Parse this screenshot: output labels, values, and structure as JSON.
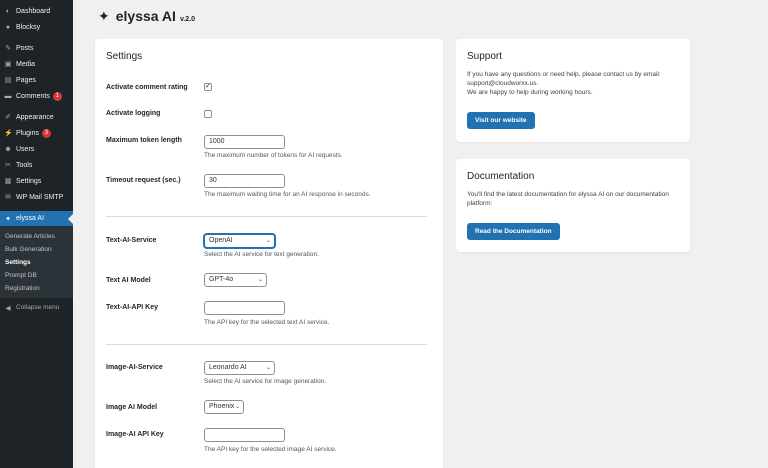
{
  "sidebar": {
    "items": [
      {
        "icon": "dashboard-icon",
        "glyph": "◐",
        "label": "Dashboard"
      },
      {
        "icon": "blocksy-icon",
        "glyph": "●",
        "label": "Blocksy"
      },
      {
        "icon": "pin-icon",
        "glyph": "✎",
        "label": "Posts"
      },
      {
        "icon": "media-icon",
        "glyph": "▣",
        "label": "Media"
      },
      {
        "icon": "pages-icon",
        "glyph": "▤",
        "label": "Pages"
      },
      {
        "icon": "comment-icon",
        "glyph": "▬",
        "label": "Comments",
        "badge": "1"
      },
      {
        "icon": "appearance-icon",
        "glyph": "✐",
        "label": "Appearance"
      },
      {
        "icon": "plugins-icon",
        "glyph": "⚡",
        "label": "Plugins",
        "badge": "3"
      },
      {
        "icon": "users-icon",
        "glyph": "☻",
        "label": "Users"
      },
      {
        "icon": "tools-icon",
        "glyph": "✂",
        "label": "Tools"
      },
      {
        "icon": "settings-icon",
        "glyph": "▦",
        "label": "Settings"
      },
      {
        "icon": "mail-icon",
        "glyph": "✉",
        "label": "WP Mail SMTP"
      }
    ],
    "active": {
      "icon": "sparkle-icon",
      "glyph": "✦",
      "label": "elyssa AI"
    },
    "submenu": [
      "Generate Articles",
      "Bulk Generation",
      "Settings",
      "Prompt DB",
      "Registration"
    ],
    "collapse_label": "Collapse menu"
  },
  "header": {
    "brand": "elyssa AI",
    "version": "v.2.0"
  },
  "settings": {
    "title": "Settings",
    "activate_comment_rating": {
      "label": "Activate comment rating",
      "checked": true
    },
    "activate_logging": {
      "label": "Activate logging",
      "checked": false
    },
    "max_token": {
      "label": "Maximum token length",
      "value": "1000",
      "desc": "The maximum number of tokens for AI requests."
    },
    "timeout": {
      "label": "Timeout request (sec.)",
      "value": "30",
      "desc": "The maximum waiting time for an AI response in seconds."
    },
    "text_service": {
      "label": "Text-AI-Service",
      "value": "OpenAI",
      "desc": "Select the AI service for text generation."
    },
    "text_model": {
      "label": "Text AI Model",
      "value": "GPT-4o"
    },
    "text_api_key": {
      "label": "Text-AI-API Key",
      "value": "",
      "desc": "The API key for the selected text AI service."
    },
    "image_service": {
      "label": "Image-AI-Service",
      "value": "Leonardo AI",
      "desc": "Select the AI service for image generation."
    },
    "image_model": {
      "label": "Image AI Model",
      "value": "Phoenix"
    },
    "image_api_key": {
      "label": "Image-AI API Key",
      "value": "",
      "desc": "The API key for the selected image AI service."
    }
  },
  "support": {
    "title": "Support",
    "line1": "If you have any questions or need help, please contact us by email:",
    "line2": "support@cloudworxx.us.",
    "line3": "We are happy to help during working hours.",
    "button": "Visit our website"
  },
  "docs": {
    "title": "Documentation",
    "line1": "You'll find the latest documentation for elyssa AI on our documentation",
    "line2": "platform:",
    "button": "Read the Documentation"
  },
  "colors": {
    "accent": "#2271b1",
    "sidebar_bg": "#1d2327",
    "badge": "#d63638"
  }
}
